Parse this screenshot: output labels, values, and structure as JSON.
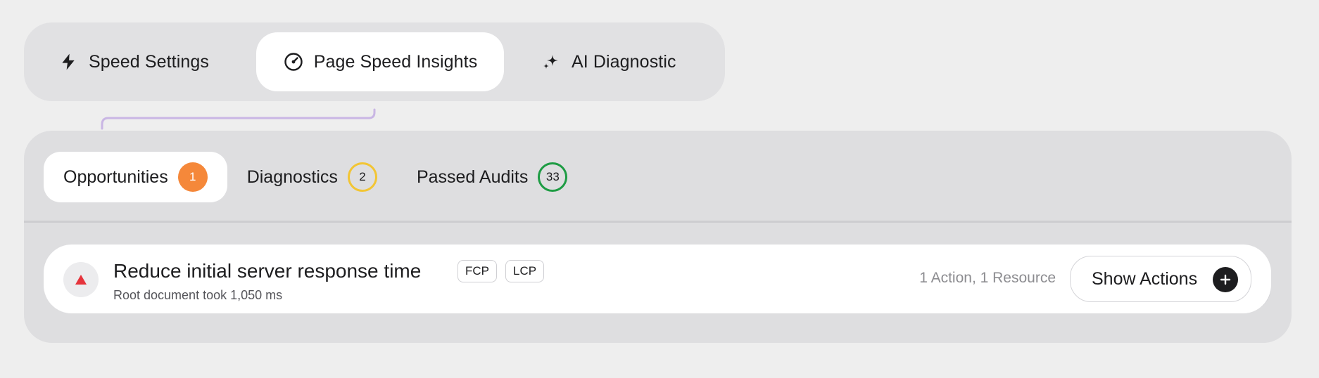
{
  "top_tabs": [
    {
      "label": "Speed Settings",
      "icon": "lightning-icon",
      "active": false
    },
    {
      "label": "Page Speed Insights",
      "icon": "gauge-icon",
      "active": true
    },
    {
      "label": "AI Diagnostic",
      "icon": "sparkles-icon",
      "active": false
    }
  ],
  "sub_tabs": [
    {
      "label": "Opportunities",
      "count": "1",
      "color": "#f5883a",
      "active": true
    },
    {
      "label": "Diagnostics",
      "count": "2",
      "color": "#f2c534",
      "active": false
    },
    {
      "label": "Passed Audits",
      "count": "33",
      "color": "#1e9c44",
      "active": false
    }
  ],
  "audit": {
    "title": "Reduce initial server response time",
    "tags": [
      "FCP",
      "LCP"
    ],
    "subtitle": "Root document took 1,050 ms",
    "meta": "1 Action, 1 Resource",
    "button_label": "Show Actions",
    "severity_color": "#e5333b",
    "severity_icon": "triangle-warning-icon"
  },
  "colors": {
    "accent_connector": "#c9b6e4",
    "background": "#eeeeee"
  }
}
